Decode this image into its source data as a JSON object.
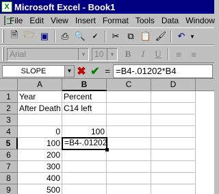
{
  "window": {
    "title": "Microsoft Excel - Book1",
    "app_icon": "excel-icon"
  },
  "menu": [
    "File",
    "Edit",
    "View",
    "Insert",
    "Format",
    "Tools",
    "Data",
    "Window"
  ],
  "standard_toolbar": {
    "buttons": [
      "new-icon",
      "open-icon",
      "save-icon",
      "print-icon",
      "print-preview-icon",
      "spelling-icon",
      "cut-icon",
      "copy-icon",
      "paste-icon",
      "format-painter-icon",
      "undo-icon"
    ]
  },
  "formatting_toolbar": {
    "font": "Arial",
    "size": "10",
    "buttons": [
      "bold-icon",
      "italic-icon",
      "underline-icon",
      "align-left-icon",
      "align-center-icon"
    ]
  },
  "formula_bar": {
    "name_box": "SLOPE",
    "formula": "=B4-.01202*B4"
  },
  "sheet": {
    "columns": [
      "A",
      "B",
      "C",
      "D"
    ],
    "rows": [
      "1",
      "2",
      "3",
      "4",
      "5",
      "6",
      "7",
      "8",
      "9"
    ],
    "active_cell": "B5",
    "cells": {
      "A1": "Year",
      "B1": "Percent",
      "A2": "After Death",
      "B2": "C14 left",
      "A4": "0",
      "B4": "100",
      "A5": "100",
      "B5": "=B4-.01202*B4",
      "A6": "200",
      "A7": "300",
      "A8": "400",
      "A9": "500"
    }
  },
  "colors": {
    "title_bar": "#000080",
    "chrome": "#c0c0c0",
    "cancel": "#c00000",
    "enter": "#008000"
  }
}
